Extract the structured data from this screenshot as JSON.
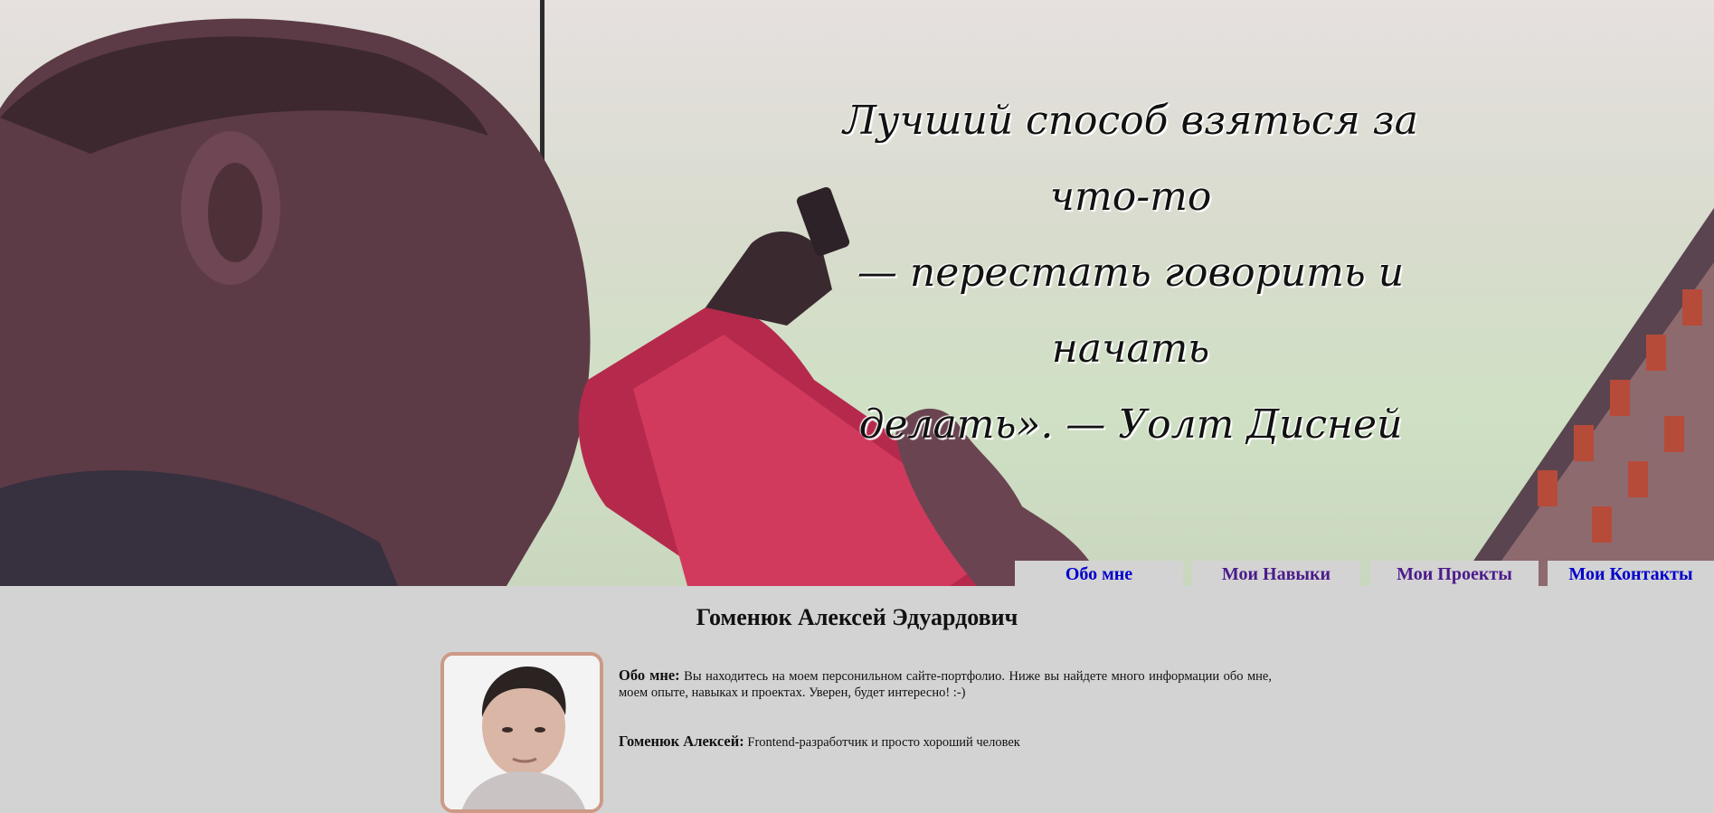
{
  "hero": {
    "quote_lines": [
      "Лучший способ взяться за что-то",
      "— перестать говорить и начать",
      "делать». — Уолт Дисней"
    ]
  },
  "nav": {
    "items": [
      {
        "label": "Обо мне"
      },
      {
        "label": "Мои Навыки"
      },
      {
        "label": "Мои Проекты"
      },
      {
        "label": "Мои Контакты"
      }
    ]
  },
  "profile": {
    "full_name": "Гоменюк Алексей Эдуардович",
    "about_label": "Обо мне:",
    "about_text": "Вы находитесь на моем персонильном сайте-портфолио. Ниже вы найдете много информации обо мне, моем опыте, навыках и проектах. Уверен, будет интересно! :-)",
    "short_label": "Гоменюк Алексей:",
    "short_text": "Frontend-разработчик и просто хороший человек"
  },
  "colors": {
    "page_bg": "#d3d3d3",
    "nav_link_blue": "#0000cc",
    "nav_link_visited": "#4b1b8a",
    "photo_border": "#cc9a86"
  }
}
